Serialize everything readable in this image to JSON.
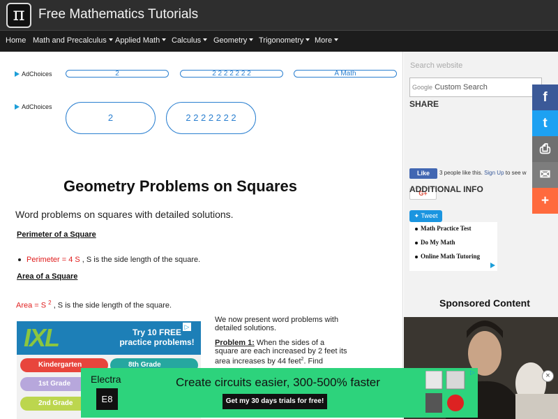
{
  "header": {
    "logo_glyph": "π",
    "site_title": "Free Mathematics Tutorials"
  },
  "nav": {
    "items": [
      "Home",
      "Math and Precalculus",
      "Applied Math",
      "Calculus",
      "Geometry",
      "Trigonometry",
      "More"
    ]
  },
  "ads": {
    "adchoices": "AdChoices",
    "row1": [
      "2",
      "2 2 2 2 2 2 2",
      "A Math"
    ],
    "row2": [
      "2",
      "2 2 2 2 2 2 2"
    ]
  },
  "article": {
    "title": "Geometry Problems on Squares",
    "subtitle": "Word problems on squares with detailed solutions.",
    "perimeter_heading": "Perimeter of a Square",
    "perimeter_formula": "Perimeter = 4 S",
    "perimeter_desc": ", S is the side length of the square.",
    "area_heading": "Area of a Square",
    "area_formula": "Area = S",
    "area_exp": "2",
    "area_desc": ", S is the side length of the square.",
    "intro": "We now present word problems with detailed solutions.",
    "problem1_label": "Problem 1:",
    "problem1_text": "When the sides of a square are each increased by 2 feet its area increases by 44 feet",
    "problem1_exp": "2",
    "problem1_end": ". Find"
  },
  "ixl_ad": {
    "logo": "IXL",
    "tagline": "Try 10 FREE practice problems!",
    "grades": [
      "Kindergarten",
      "8th Grade",
      "1st Grade",
      "2nd Grade"
    ],
    "close_icon": "ad-info-icon",
    "colors": {
      "bar": "#1d7fb7",
      "logo": "#8cc63f"
    }
  },
  "sidebar": {
    "search_label": "Search website",
    "search_placeholder": "Custom Search",
    "google_word": "Google",
    "share_title": "SHARE",
    "like_label": "Like",
    "like_text": "3 people like this.",
    "signup_label": "Sign Up",
    "signup_rest": "to see w",
    "gplus_label": "G+",
    "tweet_label": "Tweet",
    "additional_title": "ADDITIONAL INFO",
    "links": [
      "Math Practice Test",
      "Do My Math",
      "Online Math Tutoring"
    ],
    "sponsored_title": "Sponsored Content"
  },
  "share_bar": [
    {
      "icon": "facebook-icon",
      "glyph": "f",
      "color": "#3b5998"
    },
    {
      "icon": "twitter-icon",
      "glyph": "t",
      "color": "#1da1f2"
    },
    {
      "icon": "print-icon",
      "glyph": "⎙",
      "color": "#707070"
    },
    {
      "icon": "email-icon",
      "glyph": "✉",
      "color": "#7d7d7d"
    },
    {
      "icon": "plus-icon",
      "glyph": "+",
      "color": "#ff6a3d"
    }
  ],
  "bottom_ad": {
    "brand": "Electra",
    "badge": "E8",
    "headline": "Create circuits easier, 300-500% faster",
    "cta": "Get my 30 days trials for free!",
    "close_icon": "close-icon",
    "close_glyph": "×",
    "color": "#2dd37c"
  }
}
